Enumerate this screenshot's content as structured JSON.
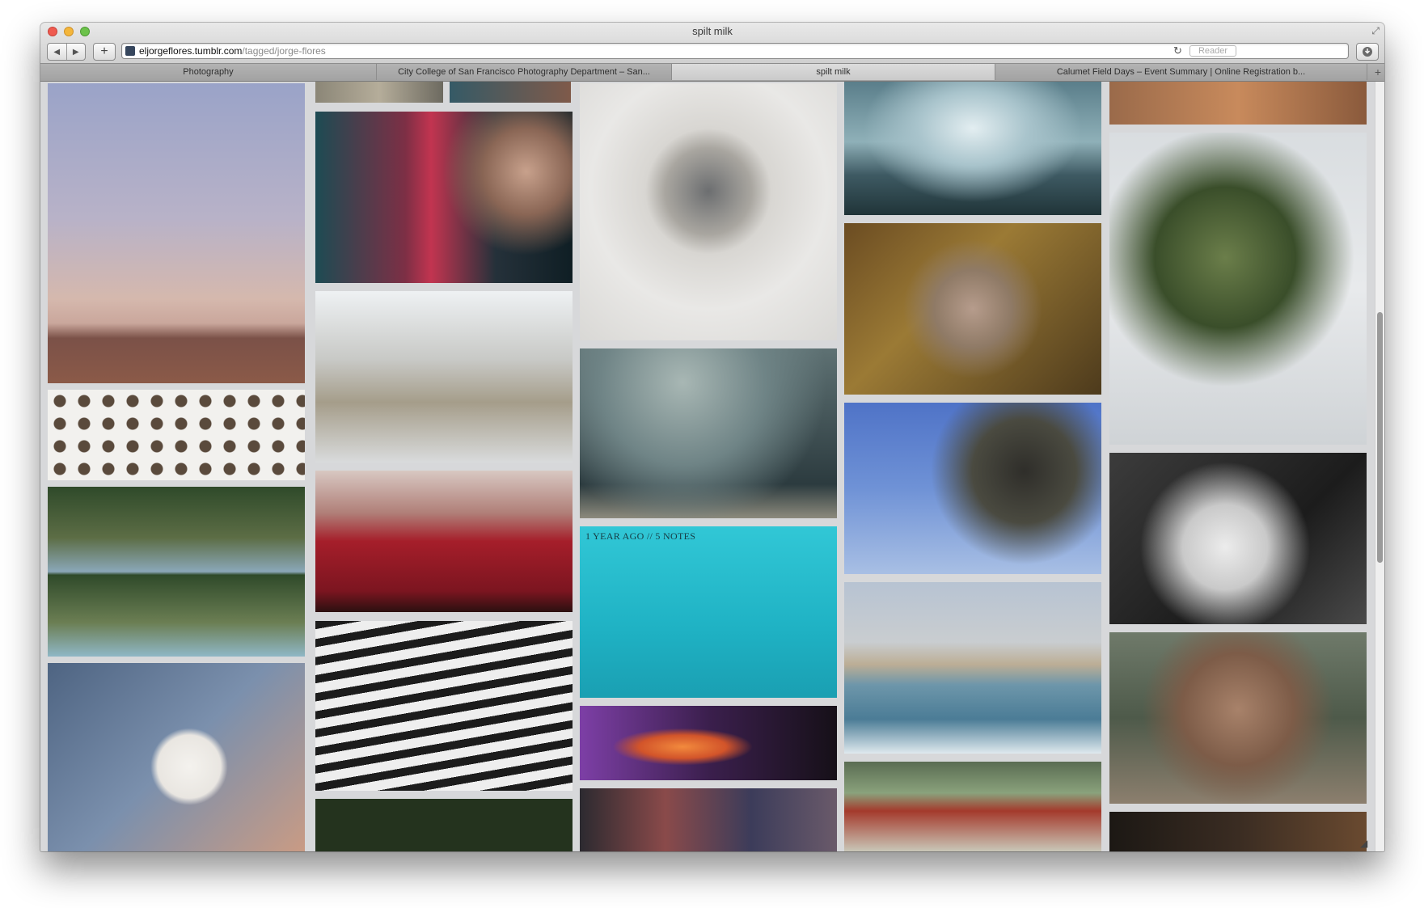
{
  "window": {
    "title": "spilt milk"
  },
  "toolbar": {
    "back_label": "◀",
    "forward_label": "▶",
    "add_label": "+",
    "url_domain": "eljorgeflores.tumblr.com",
    "url_path": "/tagged/jorge-flores",
    "reader_label": "Reader"
  },
  "tabs": [
    {
      "label": "Photography"
    },
    {
      "label": "City College of San Francisco Photography Department – San..."
    },
    {
      "label": "spilt milk"
    },
    {
      "label": "Calumet Field Days – Event Summary | Online Registration b..."
    }
  ],
  "posts": {
    "hover_caption": "1 YEAR AGO // 5 NOTES"
  }
}
